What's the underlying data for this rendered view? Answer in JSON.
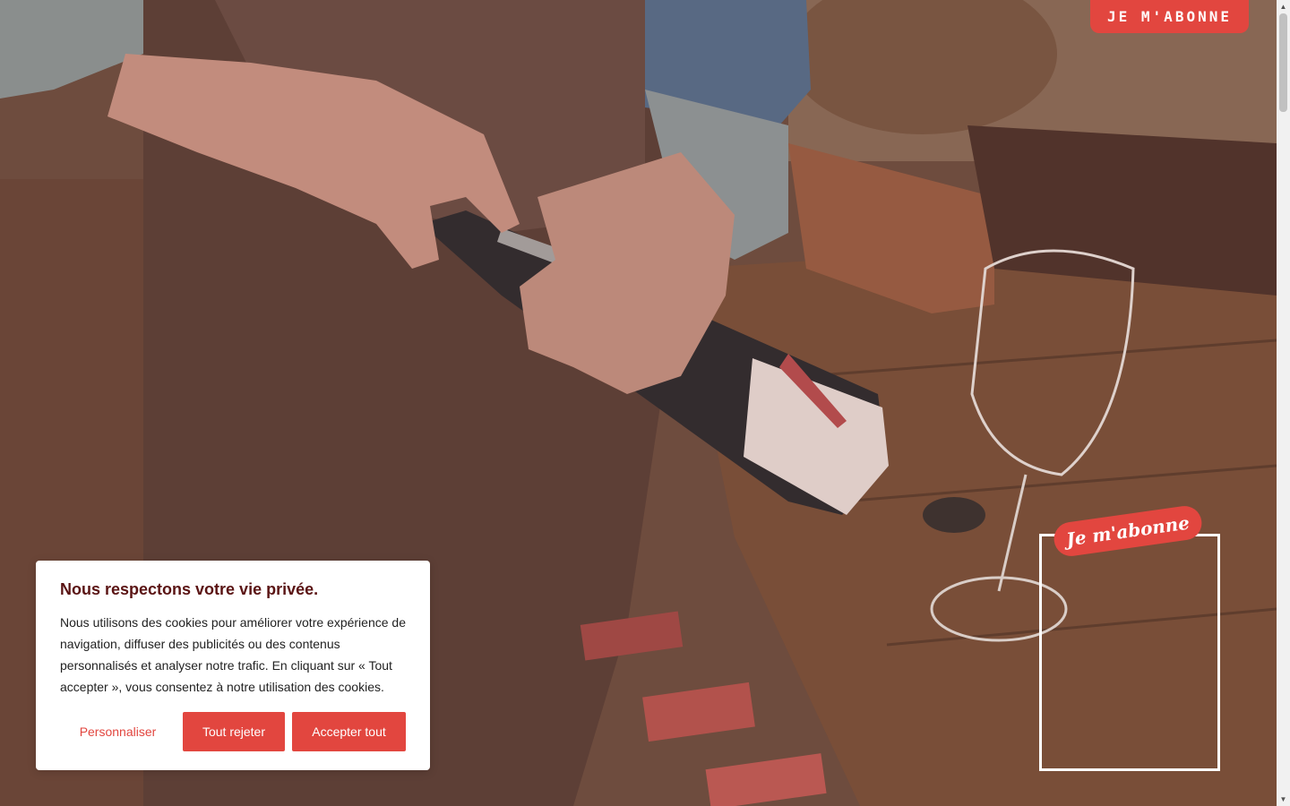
{
  "header": {
    "subscribe_label": "JE M'ABONNE"
  },
  "promo": {
    "ribbon_label": "Je m'abonne"
  },
  "cookie_banner": {
    "title": "Nous respectons votre vie privée.",
    "text": "Nous utilisons des cookies pour améliorer votre expérience de navigation, diffuser des publicités ou des contenus personnalisés et analyser notre trafic. En cliquant sur « Tout accepter », vous consentez à notre utilisation des cookies.",
    "buttons": {
      "customize": "Personnaliser",
      "reject": "Tout rejeter",
      "accept": "Accepter tout"
    }
  },
  "colors": {
    "accent": "#e2463f",
    "title": "#5a1414"
  },
  "icons": {
    "scroll_up": "triangle-up-icon",
    "scroll_down": "triangle-down-icon"
  }
}
